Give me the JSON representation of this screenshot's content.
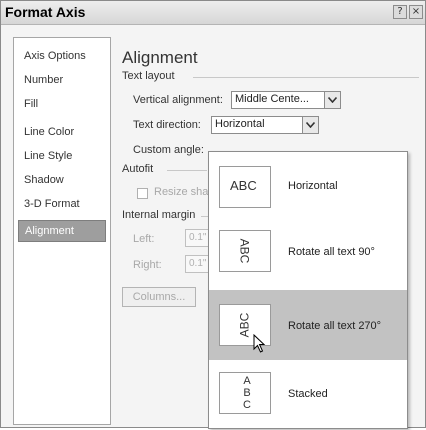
{
  "dialog": {
    "title": "Format Axis",
    "help_label": "?",
    "close_label": "×"
  },
  "nav": {
    "items": [
      {
        "label": "Axis Options"
      },
      {
        "label": "Number"
      },
      {
        "label": "Fill"
      },
      {
        "label": "Line Color"
      },
      {
        "label": "Line Style"
      },
      {
        "label": "Shadow"
      },
      {
        "label": "3-D Format"
      },
      {
        "label": "Alignment",
        "selected": true
      }
    ]
  },
  "alignment": {
    "title": "Alignment",
    "text_layout": {
      "group_label": "Text layout",
      "vertical_alignment_label": "Vertical alignment:",
      "vertical_alignment_value": "Middle Cente...",
      "text_direction_label": "Text direction:",
      "text_direction_value": "Horizontal",
      "custom_angle_label": "Custom angle:"
    },
    "autofit": {
      "group_label": "Autofit",
      "resize_label": "Resize sha"
    },
    "internal_margin": {
      "group_label": "Internal margin",
      "left_label": "Left:",
      "left_value": "0.1\"",
      "right_label": "Right:",
      "right_value": "0.1\"",
      "columns_button": "Columns..."
    }
  },
  "text_direction_menu": {
    "options": [
      {
        "label": "Horizontal",
        "icon_text": "ABC",
        "icon": "horizontal-text-icon"
      },
      {
        "label": "Rotate all text 90°",
        "icon_text": "ABC",
        "icon": "rotate-90-text-icon"
      },
      {
        "label": "Rotate all text 270°",
        "icon_text": "ABC",
        "icon": "rotate-270-text-icon",
        "selected": true
      },
      {
        "label": "Stacked",
        "icon_text": [
          "A",
          "B",
          "C"
        ],
        "icon": "stacked-text-icon"
      }
    ]
  },
  "colors": {
    "selection": "#9e9e9e",
    "menu_highlight": "#c2c2c2"
  }
}
